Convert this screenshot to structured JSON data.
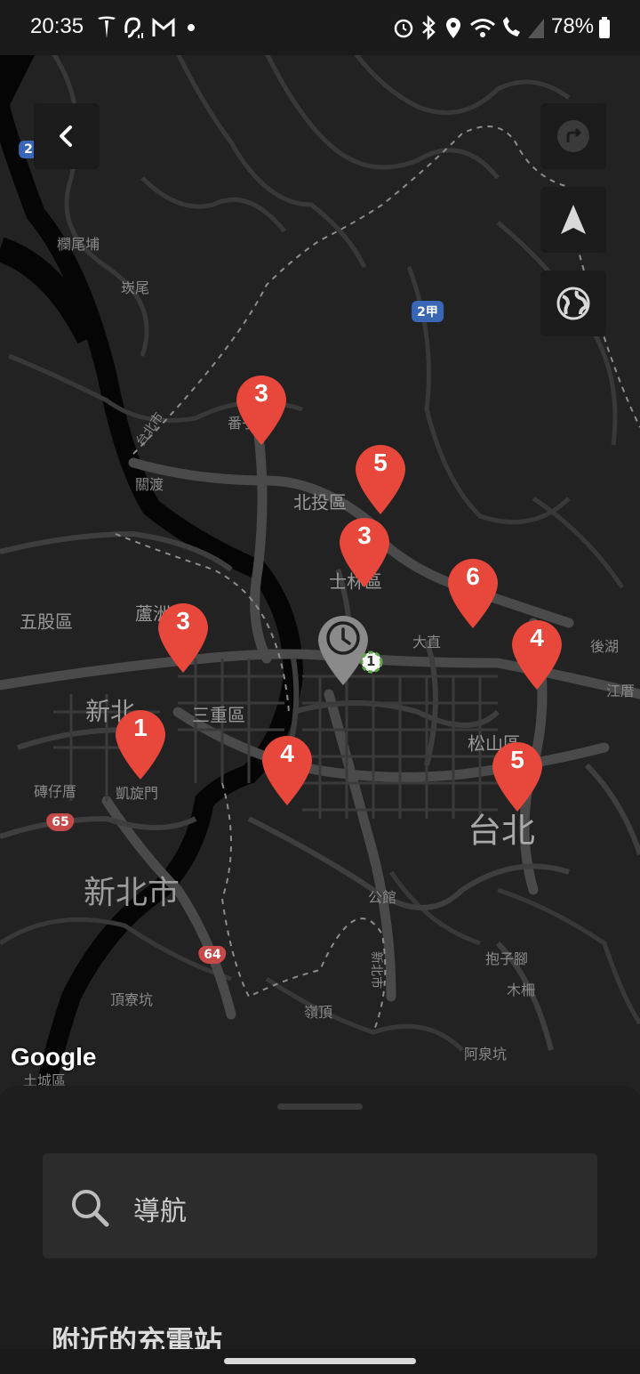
{
  "status_bar": {
    "time": "20:35",
    "battery": "78%",
    "left_icons": [
      "tesla-icon",
      "hearing-icon",
      "gmail-icon",
      "dot-icon"
    ],
    "right_icons": [
      "alarm-icon",
      "bluetooth-icon",
      "location-icon",
      "wifi-icon",
      "wifi-calling-icon",
      "signal-icon",
      "battery-icon"
    ]
  },
  "map": {
    "labels": {
      "lanweipu": "欄尾埔",
      "qianwei": "崁尾",
      "taibeishi_road": "台北市",
      "guandu": "關渡",
      "fanzai": "番子",
      "beitou": "北投區",
      "shilin": "士林區",
      "wugu": "五股區",
      "luzhou": "蘆洲",
      "sanchong": "三重區",
      "xinbei_partial": "新北",
      "dazhi": "大直",
      "houhu": "後湖",
      "jiangcuo": "江厝",
      "songshan": "松山區",
      "zhuanzaicuo": "磚仔厝",
      "kaixuanmen": "凱旋門",
      "taipei": "台北",
      "xinbeishi": "新北市",
      "gongguan": "公館",
      "xinhai_road": "新北市",
      "baozijiao": "抱子腳",
      "muzha": "木柵",
      "dingliaokeng": "頂寮坑",
      "lingding": "嶺頂",
      "aquankeng": "阿泉坑",
      "tucheng": "土城區"
    },
    "shields": {
      "route_2jia": "2甲",
      "route_65": "65",
      "route_64": "64",
      "route_2": "2"
    },
    "pins": [
      {
        "count": "3"
      },
      {
        "count": "5"
      },
      {
        "count": "3"
      },
      {
        "count": "6"
      },
      {
        "count": "3"
      },
      {
        "count": "4"
      },
      {
        "count": "1"
      },
      {
        "count": "4"
      },
      {
        "count": "5"
      }
    ],
    "pin_color": "#e8483b",
    "selected_badge": "1",
    "google_logo": "Google",
    "buttons": [
      "back-button",
      "route-button",
      "locate-button",
      "globe-button"
    ]
  },
  "sheet": {
    "search_placeholder": "導航",
    "nearby_title": "附近的充電站"
  }
}
